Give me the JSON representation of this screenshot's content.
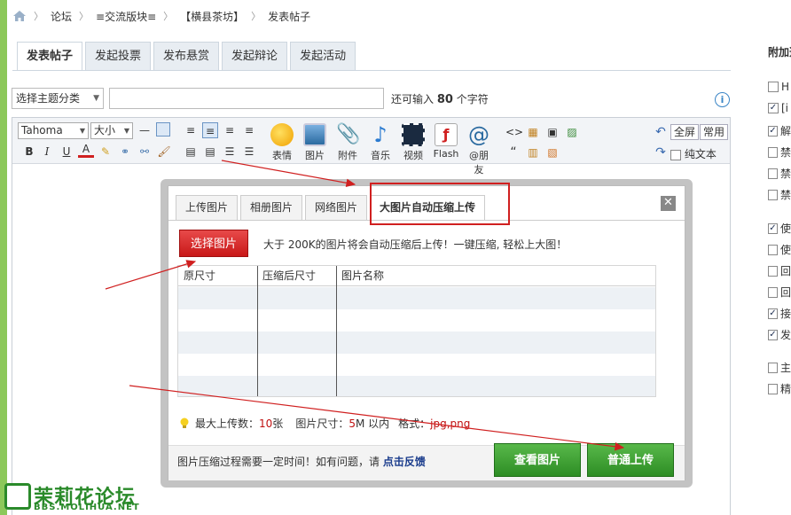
{
  "breadcrumb": [
    "论坛",
    "≡交流版块≡",
    "【横县茶坊】",
    "发表帖子"
  ],
  "tabs": [
    "发表帖子",
    "发起投票",
    "发布悬赏",
    "发起辩论",
    "发起活动"
  ],
  "subject": {
    "category_select": "选择主题分类",
    "remaining_prefix": "还可输入",
    "remaining_count": "80",
    "remaining_suffix": "个字符"
  },
  "toolbar": {
    "font": "Tahoma",
    "size": "大小",
    "big_buttons": [
      "表情",
      "图片",
      "附件",
      "音乐",
      "视频",
      "Flash",
      "@朋友"
    ],
    "fullscreen": "全屏",
    "common": "常用",
    "plain_text": "纯文本"
  },
  "right_panel": {
    "title": "附加选项",
    "options": [
      {
        "label": "H",
        "checked": false
      },
      {
        "label": "[i",
        "checked": true
      },
      {
        "label": "解",
        "checked": true
      },
      {
        "label": "禁",
        "checked": false
      },
      {
        "label": "禁",
        "checked": false
      },
      {
        "label": "禁",
        "checked": false
      },
      {
        "label": "使",
        "checked": true
      },
      {
        "label": "使",
        "checked": false
      },
      {
        "label": "回",
        "checked": false
      },
      {
        "label": "回",
        "checked": false
      },
      {
        "label": "接",
        "checked": true
      },
      {
        "label": "发",
        "checked": true
      },
      {
        "label": "主",
        "checked": false
      },
      {
        "label": "精",
        "checked": false
      }
    ]
  },
  "dialog": {
    "tabs": [
      "上传图片",
      "相册图片",
      "网络图片",
      "大图片自动压缩上传"
    ],
    "choose_button": "选择图片",
    "tip": "大于 200K的图片将会自动压缩后上传！一键压缩, 轻松上大图！",
    "columns": [
      "原尺寸",
      "压缩后尺寸",
      "图片名称"
    ],
    "limits": {
      "max_label": "最大上传数：",
      "max_value": "10",
      "max_unit": " 张",
      "size_label": "图片尺寸：",
      "size_value": "5",
      "size_unit": " M 以内",
      "format_label": "格式：",
      "format_value": "jpg,png"
    },
    "footer_note": "图片压缩过程需要一定时间！如有问题，请 ",
    "feedback_link": "点击反馈",
    "view_button": "查看图片",
    "upload_button": "普通上传"
  },
  "watermark": {
    "title": "茉莉花论坛",
    "url": "BBS.MOLIHUA.NET"
  },
  "colors": {
    "accent_green": "#2d8d24",
    "accent_red": "#c81818",
    "annotation_red": "#d02020"
  }
}
